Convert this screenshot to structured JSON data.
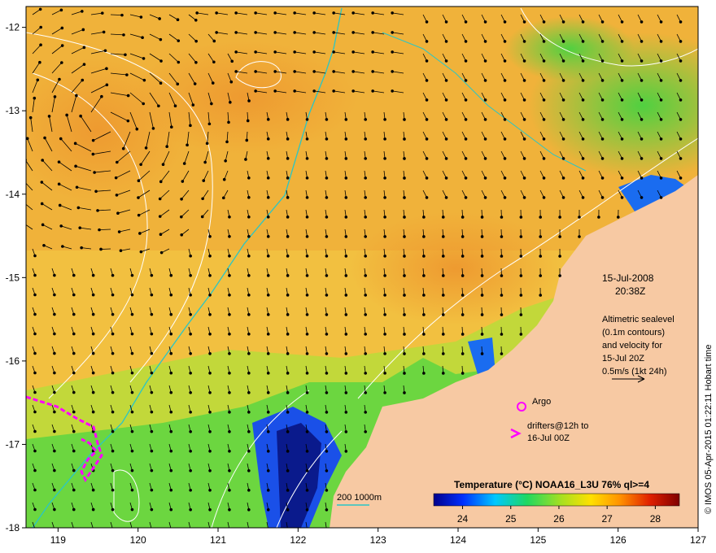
{
  "map": {
    "lon_ticks": [
      "119",
      "120",
      "121",
      "122",
      "123",
      "124",
      "125",
      "126",
      "127"
    ],
    "lat_ticks": [
      "-12",
      "-13",
      "-14",
      "-15",
      "-16",
      "-17",
      "-18"
    ],
    "colors": {
      "land": "#f7c9a3",
      "warm": "#f0a43a",
      "mid": "#f2c640",
      "cool": "#b8d838",
      "cold": "#3ccf4a",
      "deep": "#0a1a8c",
      "blue": "#1a6cf0",
      "contour": "#ffffff",
      "isobath": "#29c6c6",
      "drifter": "#ff00ff",
      "arrow": "#000000"
    }
  },
  "info": {
    "date": "15-Jul-2008",
    "time": "20:38Z",
    "alt_line1": "Altimetric sealevel",
    "alt_line2": "(0.1m contours)",
    "alt_line3": "and velocity for",
    "alt_line4": "15-Jul 20Z",
    "alt_line5": "0.5m/s (1kt 24h)"
  },
  "legend": {
    "argo": "Argo",
    "drifters_line1": "drifters@12h to",
    "drifters_line2": "16-Jul 00Z",
    "isobath": "200  1000m"
  },
  "colorbar": {
    "title": "Temperature (°C) NOAA16_L3U 76% ql>=4",
    "ticks": [
      "24",
      "25",
      "26",
      "27",
      "28"
    ]
  },
  "credit": "© IMOS 05-Apr-2015 01:22:11 Hobart time"
}
